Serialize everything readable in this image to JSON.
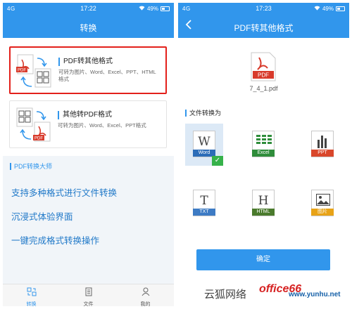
{
  "left": {
    "status": {
      "signal": "4G",
      "time": "17:22",
      "battery": "49%",
      "battery_level": 0.49
    },
    "title": "转换",
    "cards": [
      {
        "title": "PDF转其他格式",
        "desc": "可转为图片、Word、Excel、PPT、HTML格式",
        "icon_badge": "PDF"
      },
      {
        "title": "其他转PDF格式",
        "desc": "可转为图片、Word、Excel、PPT格式",
        "icon_badge": "PDF"
      }
    ],
    "master": {
      "heading": "PDF转换大师",
      "features": [
        "支持多种格式进行文件转换",
        "沉浸式体验界面",
        "一键完成格式转换操作"
      ]
    },
    "tabs": [
      {
        "label": "转换",
        "icon": "convert-icon",
        "active": true
      },
      {
        "label": "文件",
        "icon": "file-icon",
        "active": false
      },
      {
        "label": "我的",
        "icon": "person-icon",
        "active": false
      }
    ]
  },
  "right": {
    "status": {
      "signal": "4G",
      "time": "17:23",
      "battery": "49%",
      "battery_level": 0.49
    },
    "title": "PDF转其他格式",
    "file": {
      "badge": "PDF",
      "name": "7_4_1.pdf"
    },
    "convert_heading": "文件转换为",
    "formats": [
      {
        "label": "Word",
        "letter": "W",
        "color": "#2b6cb8",
        "selected": true
      },
      {
        "label": "Excel",
        "letter": "",
        "color": "#2f8d3b",
        "selected": false
      },
      {
        "label": "PPT",
        "letter": "",
        "color": "#d9472b",
        "selected": false
      },
      {
        "label": "TXT",
        "letter": "T",
        "color": "#3d7bc4",
        "selected": false
      },
      {
        "label": "HTML",
        "letter": "H",
        "color": "#4a7a2c",
        "selected": false
      },
      {
        "label": "图片",
        "letter": "",
        "color": "#e8a317",
        "selected": false
      }
    ],
    "confirm_label": "确定"
  },
  "watermark": {
    "text": "云狐网络",
    "brand": "office66",
    "site": "www.yunhu.net"
  },
  "colors": {
    "accent": "#3196ec",
    "highlight": "#e3201b",
    "pdf_red": "#d83a2b"
  }
}
